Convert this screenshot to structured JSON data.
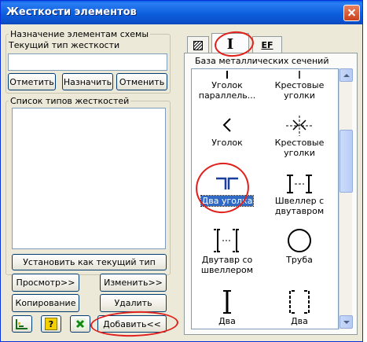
{
  "window": {
    "title": "Жесткости элементов"
  },
  "assign_group": {
    "title": "Назначение элементам схемы",
    "current_type_label": "Текущий тип жесткости",
    "current_type_value": "",
    "buttons": {
      "mark": "Отметить",
      "assign": "Назначить",
      "cancel": "Отменить"
    }
  },
  "types_group": {
    "title": "Список типов жесткостей",
    "items": []
  },
  "actions": {
    "set_current": "Установить как текущий тип",
    "preview": "Просмотр>>",
    "edit": "Изменить>>",
    "copy": "Копирование",
    "delete": "Удалить",
    "add": "Добавить<<",
    "help_icon_text": "?"
  },
  "tabs": [
    {
      "name": "parametric-sections-tab",
      "label": ""
    },
    {
      "name": "metal-sections-tab",
      "label": "I"
    },
    {
      "name": "numeric-sections-tab",
      "label": "EF"
    }
  ],
  "catalog": {
    "header": "База металлических сечений",
    "items": [
      {
        "name": "single-angle-parallel",
        "label_lines": [
          "Уголок",
          "параллель..."
        ],
        "selected": false
      },
      {
        "name": "cross-angles-top",
        "label_lines": [
          "Крестовые",
          "уголки"
        ],
        "selected": false
      },
      {
        "name": "single-angle",
        "label_lines": [
          "Уголок"
        ],
        "selected": false
      },
      {
        "name": "cross-angles",
        "label_lines": [
          "Крестовые",
          "уголки"
        ],
        "selected": false
      },
      {
        "name": "two-angles",
        "label_lines": [
          "Два уголка"
        ],
        "selected": true
      },
      {
        "name": "channel-with-ibeam",
        "label_lines": [
          "Швеллер с",
          "двутавром"
        ],
        "selected": false
      },
      {
        "name": "ibeam-with-channel",
        "label_lines": [
          "Двутавр со",
          "швеллером"
        ],
        "selected": false
      },
      {
        "name": "pipe",
        "label_lines": [
          "Труба"
        ],
        "selected": false
      },
      {
        "name": "two-ibeams",
        "label_lines": [
          "Два"
        ],
        "selected": false
      },
      {
        "name": "two-channels",
        "label_lines": [
          "Два"
        ],
        "selected": false
      }
    ]
  },
  "colors": {
    "title_bar": "#0a5fe6",
    "selection": "#316ac5",
    "annotation": "#e0201c",
    "window_bg": "#ece9d8"
  }
}
